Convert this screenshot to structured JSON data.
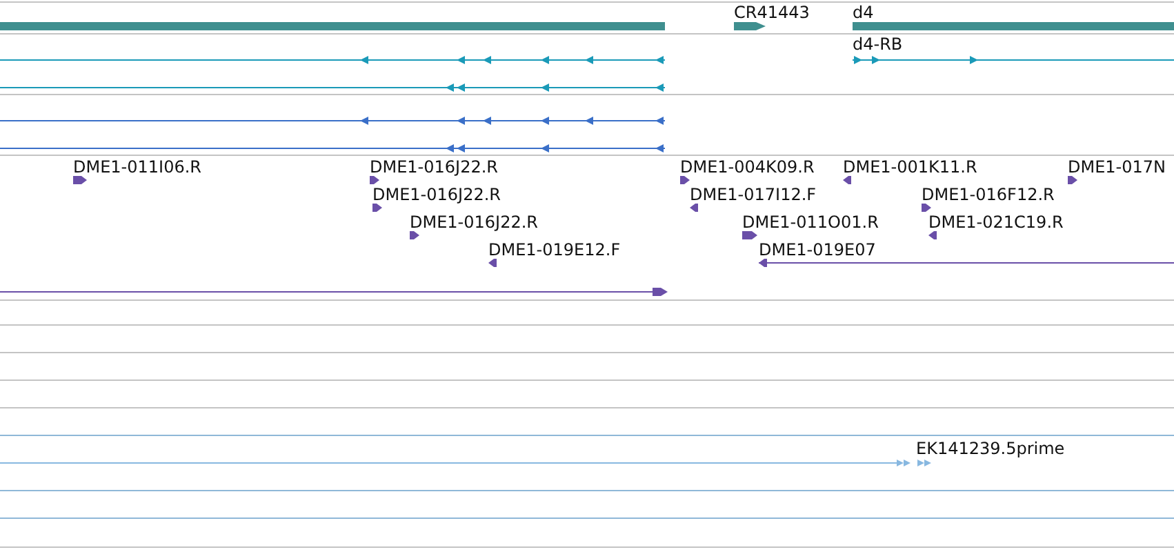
{
  "genes": [
    {
      "reverse": true
    },
    {
      "label": "CR41443",
      "reverse": false
    },
    {
      "label": "d4",
      "reverse": false
    }
  ],
  "transcripts": [
    {
      "reverse": true
    },
    {
      "reverse": true
    },
    {
      "label": "d4-RB",
      "reverse": false
    },
    {
      "reverse": true
    },
    {
      "reverse": true
    }
  ],
  "clone_ends": [
    {
      "label": "DME1-011I06.R",
      "reverse": false
    },
    {
      "label": "DME1-016J22.R",
      "reverse": false
    },
    {
      "label": "DME1-016J22.R",
      "reverse": false
    },
    {
      "label": "DME1-016J22.R",
      "reverse": false
    },
    {
      "label": "DME1-019E12.F",
      "reverse": true
    },
    {
      "reverse": false
    },
    {
      "label": "DME1-004K09.R",
      "reverse": false
    },
    {
      "label": "DME1-017I12.F",
      "reverse": true
    },
    {
      "label": "DME1-011O01.R",
      "reverse": false
    },
    {
      "label": "DME1-019E07",
      "reverse": true
    },
    {
      "label": "DME1-001K11.R",
      "reverse": true
    },
    {
      "label": "DME1-016F12.R",
      "reverse": false
    },
    {
      "label": "DME1-021C19.R",
      "reverse": true
    },
    {
      "label": "DME1-017N",
      "reverse": false
    }
  ],
  "ests": [
    {
      "label": "EK141239.5prime",
      "reverse": false
    }
  ]
}
